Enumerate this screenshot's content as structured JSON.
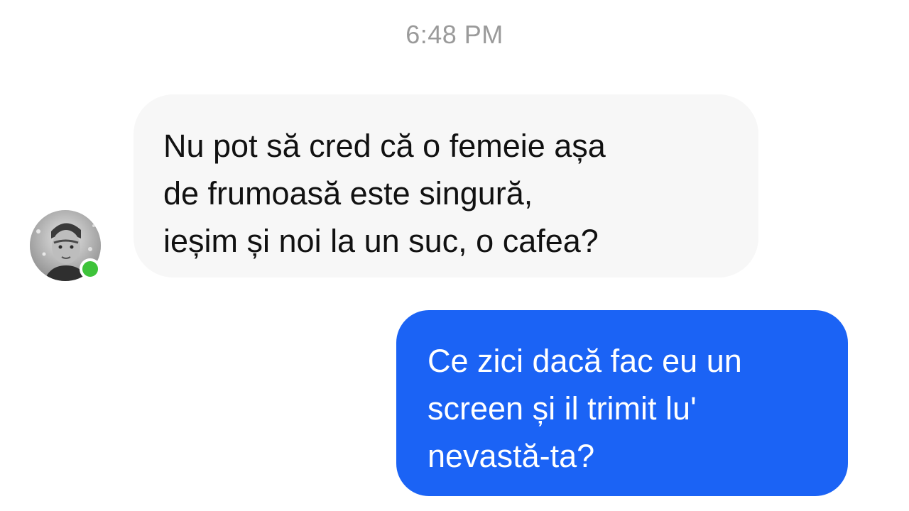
{
  "conversation": {
    "timestamp": "6:48 PM",
    "messages": [
      {
        "direction": "incoming",
        "text": "Nu pot să cred că o femeie așa\nde frumoasă este singură,\nieșim și noi la un suc, o cafea?"
      },
      {
        "direction": "outgoing",
        "text": "Ce zici dacă fac eu un\nscreen și il trimit lu'\nnevastă-ta?"
      }
    ],
    "contact": {
      "avatar_icon": "user-photo-icon",
      "online": true
    }
  },
  "colors": {
    "incoming_bubble": "#f7f7f7",
    "outgoing_bubble": "#1b63f5",
    "online_dot": "#3ec33a",
    "timestamp_text": "#9a9a9a"
  }
}
